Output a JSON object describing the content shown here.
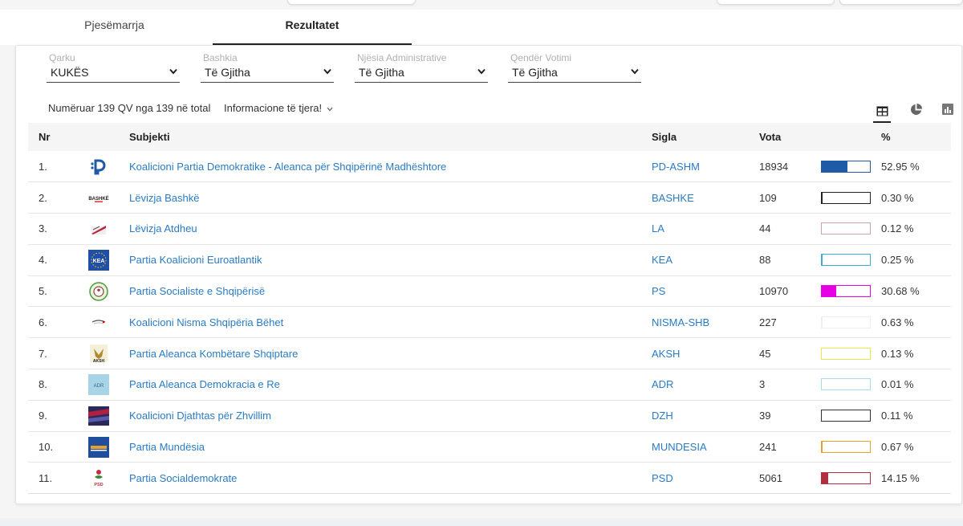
{
  "tabs": [
    {
      "label": "Pjesëmarrja"
    },
    {
      "label": "Rezultatet"
    }
  ],
  "filters": [
    {
      "label": "Qarku",
      "value": "KUKËS"
    },
    {
      "label": "Bashkia",
      "value": "Të Gjitha"
    },
    {
      "label": "Njësia Administrative",
      "value": "Të Gjitha"
    },
    {
      "label": "Qendër Votimi",
      "value": "Të Gjitha"
    }
  ],
  "info": {
    "counted": "Numëruar 139 QV nga 139 në total",
    "more": "Informacione të tjera!"
  },
  "table": {
    "headers": {
      "nr": "Nr",
      "subject": "Subjekti",
      "sigla": "Sigla",
      "vota": "Vota",
      "pct": "%"
    },
    "rows": [
      {
        "nr": "1.",
        "name": "Koalicioni Partia Demokratike - Aleanca për Shqipërinë Madhështore",
        "sigla": "PD-ASHM",
        "vota": "18934",
        "pct": "52.95 %",
        "share": 0.5295,
        "color": "#1f5aa6",
        "logo": "pd-logo"
      },
      {
        "nr": "2.",
        "name": "Lëvizja Bashkë",
        "sigla": "BASHKE",
        "vota": "109",
        "pct": "0.30 %",
        "share": 0.003,
        "color": "#222222",
        "logo": "bashke-logo"
      },
      {
        "nr": "3.",
        "name": "Lëvizja Atdheu",
        "sigla": "LA",
        "vota": "44",
        "pct": "0.12 %",
        "share": 0.0012,
        "color": "#c9a0b4",
        "logo": "la-logo"
      },
      {
        "nr": "4.",
        "name": "Partia Koalicioni Euroatlantik",
        "sigla": "KEA",
        "vota": "88",
        "pct": "0.25 %",
        "share": 0.0025,
        "color": "#3fa9d8",
        "logo": "kea-logo"
      },
      {
        "nr": "5.",
        "name": "Partia Socialiste e Shqipërisë",
        "sigla": "PS",
        "vota": "10970",
        "pct": "30.68 %",
        "share": 0.3068,
        "color": "#e600e6",
        "logo": "ps-logo"
      },
      {
        "nr": "6.",
        "name": "Koalicioni Nisma Shqipëria Bëhet",
        "sigla": "NISMA-SHB",
        "vota": "227",
        "pct": "0.63 %",
        "share": 0.0063,
        "color": "#eeeeee",
        "logo": "nisma-logo"
      },
      {
        "nr": "7.",
        "name": "Partia Aleanca Kombëtare Shqiptare",
        "sigla": "AKSH",
        "vota": "45",
        "pct": "0.13 %",
        "share": 0.0013,
        "color": "#e8e84a",
        "logo": "aksh-logo"
      },
      {
        "nr": "8.",
        "name": "Partia Aleanca Demokracia e Re",
        "sigla": "ADR",
        "vota": "3",
        "pct": "0.01 %",
        "share": 0.0001,
        "color": "#a8dcea",
        "logo": "adr-logo"
      },
      {
        "nr": "9.",
        "name": "Koalicioni Djathtas për Zhvillim",
        "sigla": "DZH",
        "vota": "39",
        "pct": "0.11 %",
        "share": 0.0011,
        "color": "#333333",
        "logo": "dzh-logo"
      },
      {
        "nr": "10.",
        "name": "Partia Mundësia",
        "sigla": "MUNDESIA",
        "vota": "241",
        "pct": "0.67 %",
        "share": 0.0067,
        "color": "#e8a02a",
        "logo": "mundesia-logo"
      },
      {
        "nr": "11.",
        "name": "Partia Socialdemokrate",
        "sigla": "PSD",
        "vota": "5061",
        "pct": "14.15 %",
        "share": 0.1415,
        "color": "#b03040",
        "logo": "psd-logo"
      }
    ]
  },
  "logo_texts": {
    "bashke": "BASHKË",
    "kea": "KEA",
    "aksh": "AKSH",
    "adr": "ADR",
    "psd": "PSD"
  }
}
